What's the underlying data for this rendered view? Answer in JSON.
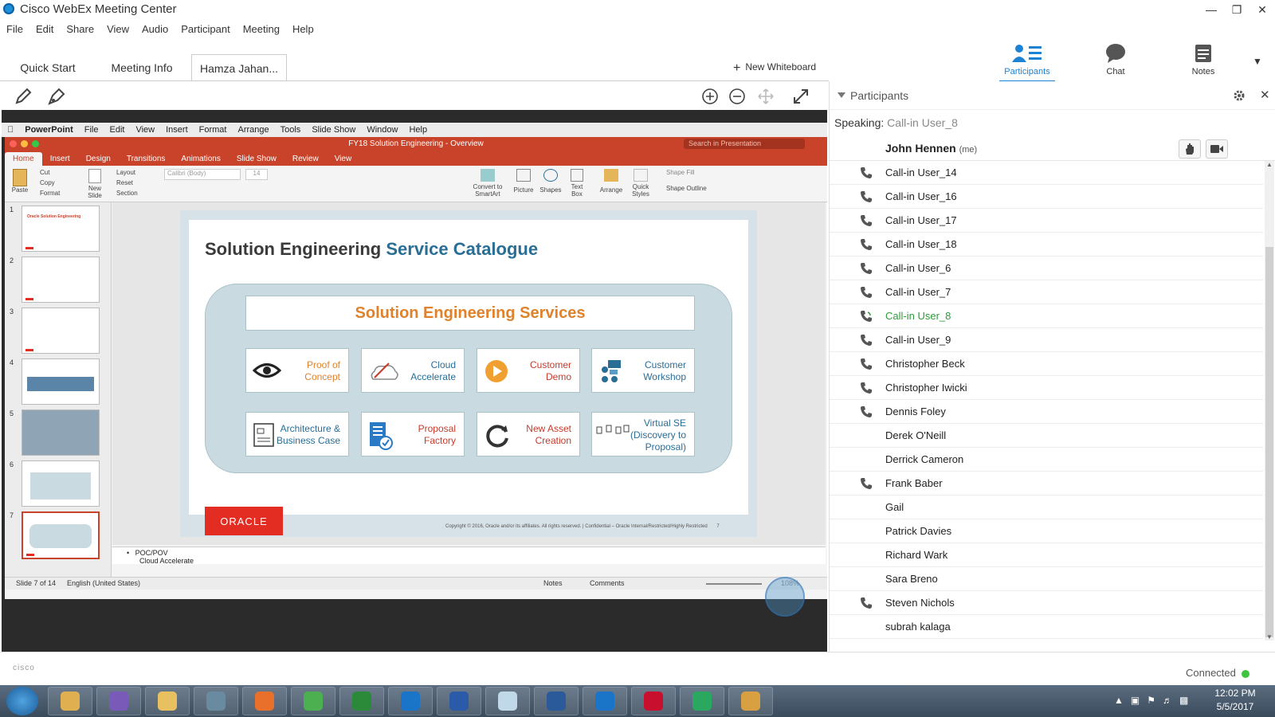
{
  "window": {
    "title": "Cisco WebEx Meeting Center"
  },
  "menu": [
    "File",
    "Edit",
    "Share",
    "View",
    "Audio",
    "Participant",
    "Meeting",
    "Help"
  ],
  "tabs": [
    {
      "label": "Quick Start",
      "active": false
    },
    {
      "label": "Meeting Info",
      "active": false
    },
    {
      "label": "Hamza Jahan...",
      "active": true
    }
  ],
  "new_whiteboard": "New Whiteboard",
  "right_toolbar": [
    {
      "label": "Participants",
      "icon": "participants-icon",
      "active": true
    },
    {
      "label": "Chat",
      "icon": "chat-icon",
      "active": false
    },
    {
      "label": "Notes",
      "icon": "notes-icon",
      "active": false
    }
  ],
  "colors": {
    "accent": "#1c82d4",
    "ppt": "#c8432a",
    "speaking": "#2e9b3a",
    "slide_title": "#2a6e96",
    "service_head": "#e0822c",
    "oracle": "#e32d22"
  },
  "shared": {
    "mac_menu": [
      "PowerPoint",
      "File",
      "Edit",
      "View",
      "Insert",
      "Format",
      "Arrange",
      "Tools",
      "Slide Show",
      "Window",
      "Help"
    ],
    "ppt_title": "FY18 Solution Engineering - Overview",
    "ppt_search": "Search in Presentation",
    "ribbon_tabs": [
      "Home",
      "Insert",
      "Design",
      "Transitions",
      "Animations",
      "Slide Show",
      "Review",
      "View"
    ],
    "ribbon": {
      "paste": "Paste",
      "cut": "Cut",
      "copy": "Copy",
      "format": "Format",
      "new_slide_1": "New",
      "new_slide_2": "Slide",
      "layout": "Layout",
      "reset": "Reset",
      "section": "Section",
      "font": "Calibri (Body)",
      "size": "14",
      "convert_1": "Convert to",
      "convert_2": "SmartArt",
      "picture": "Picture",
      "shapes": "Shapes",
      "textbox_1": "Text",
      "textbox_2": "Box",
      "arrange": "Arrange",
      "quick_1": "Quick",
      "quick_2": "Styles",
      "shape_fill": "Shape Fill",
      "shape_outline": "Shape Outline"
    },
    "thumb_numbers": [
      "1",
      "2",
      "3",
      "4",
      "5",
      "6",
      "7"
    ],
    "thumb1_title": "Oracle Solution Engineering",
    "slide": {
      "title_a": "Solution Engineering",
      "title_b": "Service Catalogue",
      "panel_title": "Solution Engineering Services",
      "services": [
        {
          "l1": "Proof of",
          "l2": "Concept",
          "color": "#e0822c",
          "icon": "eye-icon"
        },
        {
          "l1": "Cloud",
          "l2": "Accelerate",
          "color": "#2a6e96",
          "icon": "cloud-rocket-icon"
        },
        {
          "l1": "Customer",
          "l2": "Demo",
          "color": "#c83a2a",
          "icon": "play-icon"
        },
        {
          "l1": "Customer",
          "l2": "Workshop",
          "color": "#2a6e96",
          "icon": "workshop-icon"
        },
        {
          "l1": "Architecture &",
          "l2": "Business Case",
          "color": "#2a6e96",
          "icon": "architecture-icon"
        },
        {
          "l1": "Proposal",
          "l2": "Factory",
          "color": "#c83a2a",
          "icon": "proposal-icon"
        },
        {
          "l1": "New Asset",
          "l2": "Creation",
          "color": "#c83a2a",
          "icon": "refresh-icon"
        },
        {
          "l1": "Virtual SE",
          "l2": "(Discovery to Proposal)",
          "color": "#2a6e96",
          "icon": "virtual-se-icon"
        }
      ],
      "oracle": "ORACLE",
      "copyright": "Copyright © 2016, Oracle and/or its affiliates. All rights reserved. | Confidential – Oracle Internal/Restricted/Highly Restricted",
      "page": "7"
    },
    "notes_1": "POC/POV",
    "notes_2": "Cloud Accelerate",
    "status": {
      "slide": "Slide 7 of 14",
      "lang": "English (United States)",
      "notes": "Notes",
      "comments": "Comments",
      "zoom": "108%"
    }
  },
  "participants": {
    "header": "Participants",
    "speaking_label": "Speaking:",
    "speaking_name": "Call-in User_8",
    "me": {
      "name": "John Hennen",
      "tag": "(me)"
    },
    "list": [
      {
        "name": "Call-in User_14",
        "phone": true,
        "speaking": false
      },
      {
        "name": "Call-in User_16",
        "phone": true,
        "speaking": false
      },
      {
        "name": "Call-in User_17",
        "phone": true,
        "speaking": false
      },
      {
        "name": "Call-in User_18",
        "phone": true,
        "speaking": false
      },
      {
        "name": "Call-in User_6",
        "phone": true,
        "speaking": false
      },
      {
        "name": "Call-in User_7",
        "phone": true,
        "speaking": false
      },
      {
        "name": "Call-in User_8",
        "phone": true,
        "speaking": true
      },
      {
        "name": "Call-in User_9",
        "phone": true,
        "speaking": false
      },
      {
        "name": "Christopher Beck",
        "phone": true,
        "speaking": false
      },
      {
        "name": "Christopher Iwicki",
        "phone": true,
        "speaking": false
      },
      {
        "name": "Dennis Foley",
        "phone": true,
        "speaking": false
      },
      {
        "name": "Derek O'Neill",
        "phone": false,
        "speaking": false
      },
      {
        "name": "Derrick Cameron",
        "phone": false,
        "speaking": false
      },
      {
        "name": "Frank Baber",
        "phone": true,
        "speaking": false
      },
      {
        "name": "Gail",
        "phone": false,
        "speaking": false
      },
      {
        "name": "Patrick Davies",
        "phone": false,
        "speaking": false
      },
      {
        "name": "Richard Wark",
        "phone": false,
        "speaking": false
      },
      {
        "name": "Sara Breno",
        "phone": false,
        "speaking": false
      },
      {
        "name": "Steven Nichols",
        "phone": true,
        "speaking": false
      },
      {
        "name": "subrah kalaga",
        "phone": false,
        "speaking": false
      }
    ]
  },
  "footer": {
    "brand": "cisco",
    "status": "Connected"
  },
  "taskbar": {
    "apps": [
      "start-orb-icon",
      "outlook-icon",
      "pidgin-icon",
      "explorer-icon",
      "database-icon",
      "firefox-icon",
      "chrome-icon",
      "excel-icon",
      "ie-icon",
      "word-icon",
      "notepad-icon",
      "app-icon",
      "ie-icon",
      "acrobat-icon",
      "webex-icon",
      "paint-icon"
    ],
    "time": "12:02 PM",
    "date": "5/5/2017"
  }
}
